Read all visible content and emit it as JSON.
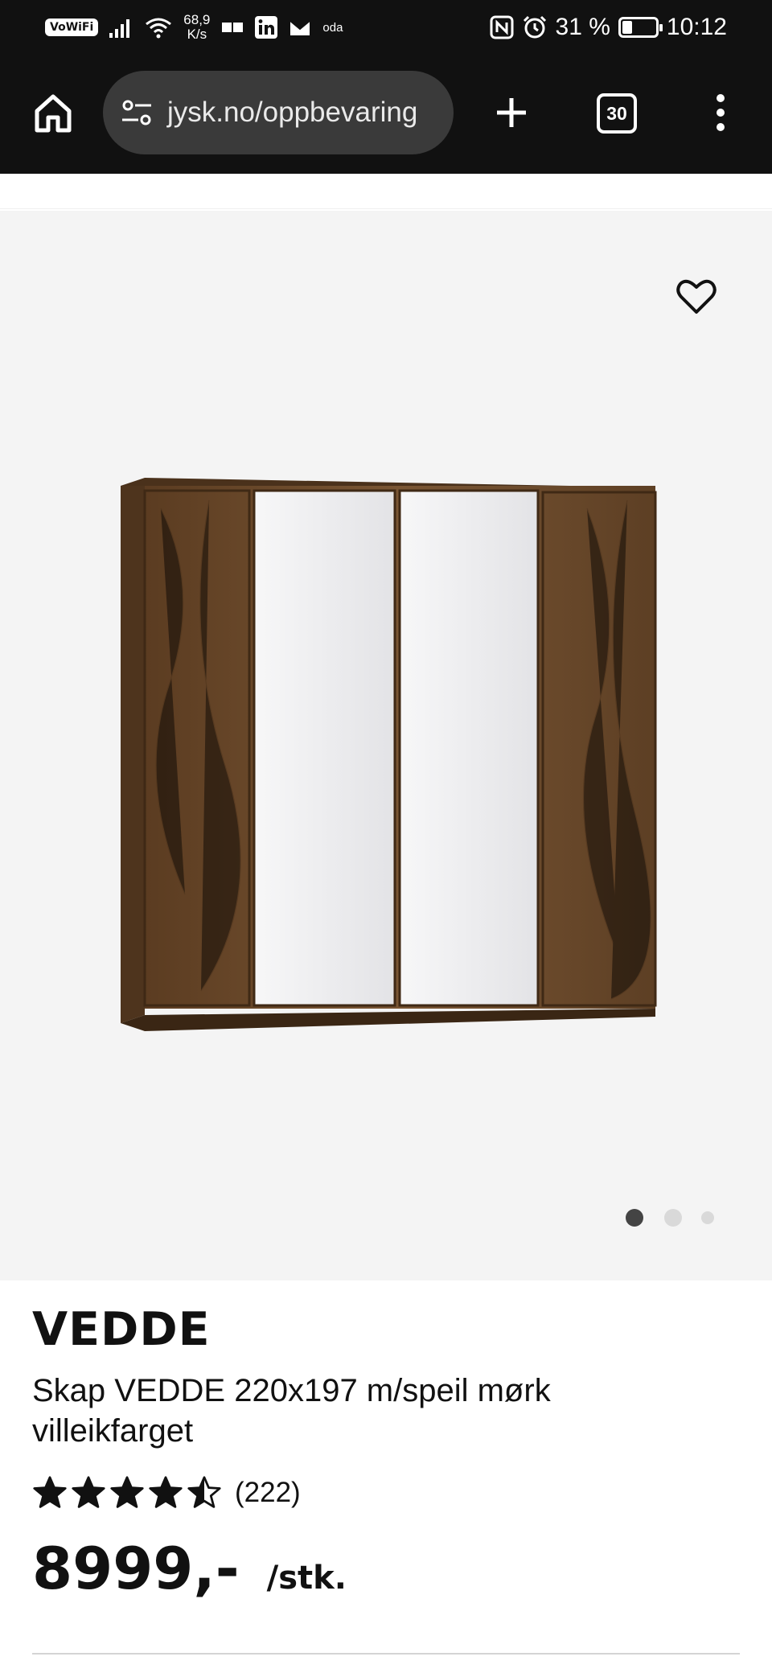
{
  "status_bar": {
    "vowifi": "VoWiFi",
    "speed_value": "68,9",
    "speed_unit": "K/s",
    "app_label": "oda",
    "battery_text": "31 %",
    "battery_level": 0.31,
    "time": "10:12"
  },
  "browser": {
    "url": "jysk.no/oppbevaring",
    "tab_count": "30"
  },
  "gallery": {
    "dot_count": 3,
    "active_index": 0
  },
  "product": {
    "brand": "VEDDE",
    "title": "Skap VEDDE 220x197 m/speil mørk villeikfarget",
    "rating": 4.5,
    "review_count": "(222)",
    "price": "8999,-",
    "unit": "/stk."
  },
  "icons": {
    "home": "home-icon",
    "site_settings": "tune-icon",
    "new_tab": "plus-icon",
    "menu": "more-vert-icon",
    "favorite": "heart-icon"
  },
  "colors": {
    "chrome": "#111111",
    "url_box": "#3a3a3a",
    "image_bg": "#f4f4f4",
    "dot_active": "#444444",
    "dot_inactive": "#d9d9d9",
    "wood": "#6b4a2b",
    "mirror": "#ececee"
  }
}
